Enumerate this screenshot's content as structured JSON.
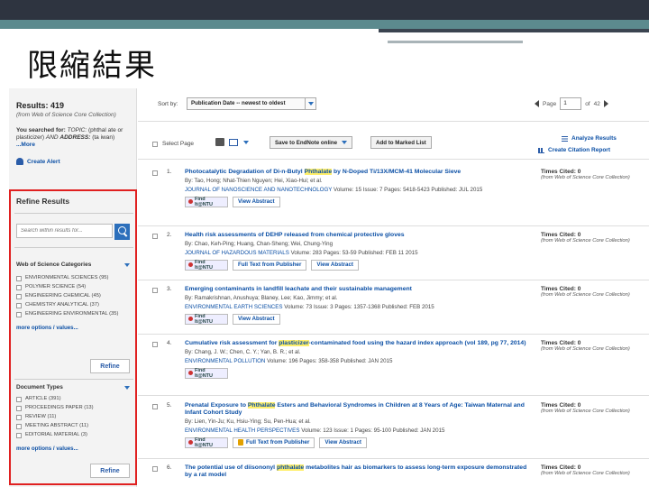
{
  "slide": {
    "title": "限縮結果"
  },
  "sidebar": {
    "results_title": "Results: 419",
    "results_source": "(from Web of Science Core Collection)",
    "searched_label": "You searched for:",
    "searched_topic_label": "TOPIC:",
    "searched_topic": "(phthal ate or plasticizer)",
    "searched_and": "AND",
    "searched_address_label": "ADDRESS:",
    "searched_address": "(ta iwan)",
    "more_label": "...More",
    "create_alert": "Create Alert",
    "refine_title": "Refine Results",
    "search_placeholder": "Search within results for...",
    "categories_title": "Web of Science Categories",
    "categories": [
      {
        "label": "ENVIRONMENTAL SCIENCES (95)"
      },
      {
        "label": "POLYMER SCIENCE (54)"
      },
      {
        "label": "ENGINEERING CHEMICAL (45)"
      },
      {
        "label": "CHEMISTRY ANALYTICAL (37)"
      },
      {
        "label": "ENGINEERING ENVIRONMENTAL (35)"
      }
    ],
    "more_options": "more options / values...",
    "refine_button": "Refine",
    "doctypes_title": "Document Types",
    "doctypes": [
      {
        "label": "ARTICLE (391)"
      },
      {
        "label": "PROCEEDINGS PAPER (13)"
      },
      {
        "label": "REVIEW (11)"
      },
      {
        "label": "MEETING ABSTRACT (11)"
      },
      {
        "label": "EDITORIAL MATERIAL (3)"
      }
    ],
    "more_options_2": "more options / values...",
    "refine_button_2": "Refine"
  },
  "sortbar": {
    "sort_label": "Sort by:",
    "sort_value": "Publication Date -- newest to oldest",
    "page_label": "Page",
    "page_value": "1",
    "page_of": "of",
    "page_total": "42"
  },
  "toolbar": {
    "select_page": "Select Page",
    "save_endnote": "Save to EndNote online",
    "add_marked": "Add to Marked List",
    "analyze": "Analyze Results",
    "citation_report": "Create Citation Report"
  },
  "records": [
    {
      "num": "1.",
      "title_pre": "Photocatalytic Degradation of Di-n-Butyl ",
      "title_hl": "Phthalate",
      "title_post": " by N-Doped Ti/13X/MCM-41 Molecular Sieve",
      "authors": "By: Tao, Hong; Nhat-Thien Nguyen; Hei, Xiao-Hui; et al.",
      "journal": "JOURNAL OF NANOSCIENCE AND NANOTECHNOLOGY",
      "details": "Volume: 15   Issue: 7   Pages: 5418-5423   Published: JUL 2015",
      "findit": "Find It@NTU",
      "actions": [
        "View Abstract"
      ],
      "cited": "Times Cited: 0",
      "cited_src": "(from Web of Science Core Collection)"
    },
    {
      "num": "2.",
      "title_pre": "Health risk assessments of DEHP released from chemical protective gloves",
      "title_hl": "",
      "title_post": "",
      "authors": "By: Chao, Keh-Ping; Huang, Chan-Sheng; Wei, Chung-Ying",
      "journal": "JOURNAL OF HAZARDOUS MATERIALS",
      "details": "Volume: 283   Pages: 53-59   Published: FEB 11 2015",
      "findit": "Find It@NTU",
      "actions": [
        "Full Text from Publisher",
        "View Abstract"
      ],
      "cited": "Times Cited: 0",
      "cited_src": "(from Web of Science Core Collection)"
    },
    {
      "num": "3.",
      "title_pre": "Emerging contaminants in landfill leachate and their sustainable management",
      "title_hl": "",
      "title_post": "",
      "authors": "By: Ramakrishnan, Anushuya; Blaney, Lee; Kao, Jimmy; et al.",
      "journal": "ENVIRONMENTAL EARTH SCIENCES",
      "details": "Volume: 73   Issue: 3   Pages: 1357-1368   Published: FEB 2015",
      "findit": "Find It@NTU",
      "actions": [
        "View Abstract"
      ],
      "cited": "Times Cited: 0",
      "cited_src": "(from Web of Science Core Collection)"
    },
    {
      "num": "4.",
      "title_pre": "Cumulative risk assessment for ",
      "title_hl": "plasticizer",
      "title_post": "-contaminated food using the hazard index approach (vol 189, pg 77, 2014)",
      "authors": "By: Chang, J. W.; Chen, C. Y.; Yan, B. R.; et al.",
      "journal": "ENVIRONMENTAL POLLUTION",
      "details": "Volume: 196   Pages: 358-358   Published: JAN 2015",
      "findit": "Find It@NTU",
      "actions": [],
      "cited": "Times Cited: 0",
      "cited_src": "(from Web of Science Core Collection)"
    },
    {
      "num": "5.",
      "title_pre": "Prenatal Exposure to ",
      "title_hl": "Phthalate",
      "title_post": " Esters and Behavioral Syndromes in Children at 8 Years of Age: Taiwan Maternal and Infant Cohort Study",
      "authors": "By: Lien, Yin-Ju; Ku, Hsiu-Ying; Su, Pen-Hua; et al.",
      "journal": "ENVIRONMENTAL HEALTH PERSPECTIVES",
      "details": "Volume: 123   Issue: 1   Pages: 95-100   Published: JAN 2015",
      "findit": "Find It@NTU",
      "actions": [
        "Full Text from Publisher",
        "View Abstract"
      ],
      "cited": "Times Cited: 0",
      "cited_src": "(from Web of Science Core Collection)"
    },
    {
      "num": "6.",
      "title_pre": "The potential use of diisononyl ",
      "title_hl": "phthalate",
      "title_post": " metabolites hair as biomarkers to assess long-term exposure demonstrated by a rat model",
      "authors": "",
      "journal": "",
      "details": "",
      "findit": "",
      "actions": [],
      "cited": "Times Cited: 0",
      "cited_src": "(from Web of Science Core Collection)"
    }
  ]
}
